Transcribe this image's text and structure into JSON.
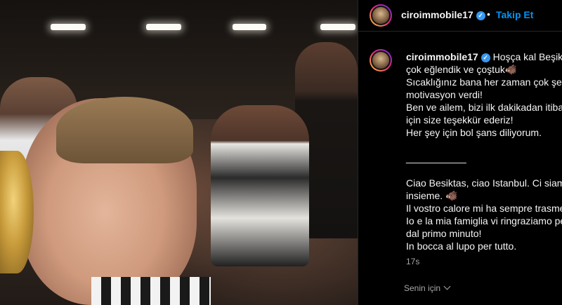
{
  "post": {
    "author": "ciroimmobile17",
    "follow_label": "Takip Et",
    "separator": "•",
    "caption_user": "ciroimmobile17",
    "caption_lines": [
      "Hoşça kal Beşiktaş",
      "çok eğlendik ve çoştuk🐗",
      "Sıcaklığınız bana her zaman çok şey",
      "motivasyon verdi!",
      "Ben ve ailem, bizi ilk dakikadan itibar",
      "için size teşekkür ederiz!",
      "Her şey için bol şans diliyorum.",
      "",
      "___________",
      "",
      "Ciao Besiktas, ciao Istanbul. Ci siamo",
      "insieme. 🐗",
      "Il vostro calore mi ha sempre trasme",
      "Io e la mia famiglia vi ringraziamo pe",
      "dal primo minuto!",
      "In bocca al lupo per tutto."
    ],
    "timestamp": "17s",
    "translation_label": "Senin için"
  },
  "icons": {
    "verified": "verified-badge-icon",
    "chevron": "chevron-down-icon"
  },
  "colors": {
    "link_blue": "#0095f6",
    "verified_blue": "#3897f0",
    "text": "#f5f5f5",
    "muted": "#a8a8a8",
    "bg": "#000000"
  }
}
